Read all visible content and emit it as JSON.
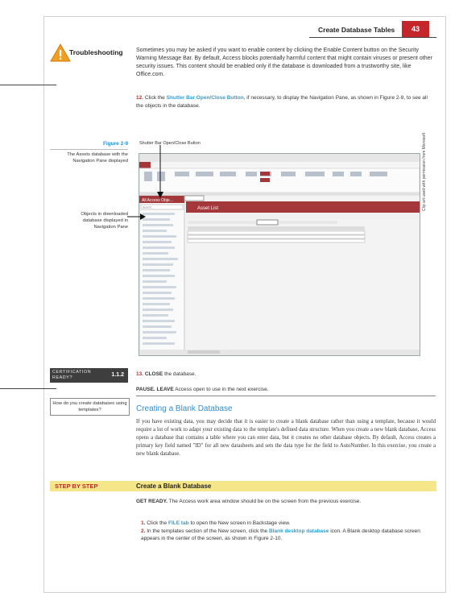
{
  "header": {
    "title": "Create Database Tables",
    "page_number": "43"
  },
  "troubleshooting": {
    "label": "Troubleshooting",
    "text": "Sometimes you may be asked if you want to enable content by clicking the Enable Content button on the Security Warning Message Bar. By default, Access blocks potentially harmful content that might contain viruses or present other security issues. This content should be enabled only if the database is downloaded from a trustworthy site, like Office.com."
  },
  "step12": {
    "number": "12.",
    "pre": "Click the",
    "highlight": "Shutter Bar Open/Close Button",
    "post": ", if necessary, to display the Navigation Pane, as shown in Figure 2-9, to see all the objects in the database."
  },
  "figure": {
    "label": "Figure 2-9",
    "caption": "The Assets database with the Navigation Pane displayed",
    "callout_top": "Shutter Bar Open/Close Button",
    "callout_left": "Objects in downloaded database displayed in Navigation Pane",
    "credit": "Clip art used with permission from Microsoft",
    "screenshot": {
      "tab_label": "Asset List",
      "nav_header": "All Access Obje...",
      "search_label": "Search..."
    }
  },
  "certification": {
    "word": "CERTIFICATION",
    "word2": "READY?",
    "number": "1.1.2",
    "question": "How do you create databases using templates?"
  },
  "step13": {
    "number": "13.",
    "bold": "CLOSE",
    "text": "the database."
  },
  "pause": {
    "bold1": "PAUSE.",
    "bold2": "LEAVE",
    "text": "Access open to use in the next exercise."
  },
  "section": {
    "title": "Creating a Blank Database",
    "body": "If you have existing data, you may decide that it is easier to create a blank database rather than using a template, because it would require a lot of work to adapt your existing data to the template's defined data structure. When you create a new blank database, Access opens a database that contains a table where you can enter data, but it creates no other database objects. By default, Access creates a primary key field named \"ID\" for all new datasheets and sets the data type for the field to AutoNumber. In this exercise, you create a new blank database."
  },
  "step_by_step": {
    "label": "STEP BY STEP",
    "title": "Create a Blank Database",
    "get_ready_bold": "GET READY.",
    "get_ready_text": "The Access work area window should be on the screen from the previous exercise.",
    "steps": [
      {
        "num": "1.",
        "pre": "Click the",
        "hl": "FILE tab",
        "post": "to open the New screen in Backstage view."
      },
      {
        "num": "2.",
        "pre": "In the templates section of the New screen, click the",
        "hl": "Blank desktop database",
        "post": "icon. A Blank desktop database screen appears in the center of the screen, as shown in Figure 2-10."
      }
    ]
  },
  "colors": {
    "accent_red": "#c5262c",
    "highlight_blue": "#2aa0d8",
    "sbs_yellow": "#f6e68a",
    "access_red": "#a4373a"
  }
}
